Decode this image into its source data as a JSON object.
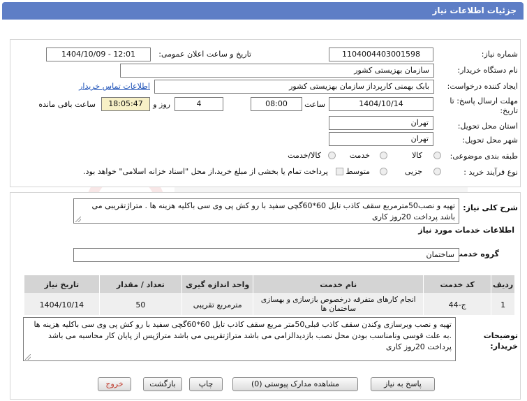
{
  "header": {
    "title": "جزئیات اطلاعات نیاز"
  },
  "form": {
    "need_number_label": "شماره نیاز:",
    "need_number": "1104004403001598",
    "announce_label": "تاریخ و ساعت اعلان عمومی:",
    "announce_value": "1404/10/09 - 12:01",
    "buyer_org_label": "نام دستگاه خریدار:",
    "buyer_org": "سازمان بهزیستی کشور",
    "creator_label": "ایجاد کننده درخواست:",
    "creator": "بابک بهمنی کارپرداز سازمان بهزیستی کشور",
    "contact_link": "اطلاعات تماس خریدار",
    "deadline_label": "مهلت ارسال پاسخ: تا تاریخ:",
    "deadline_date": "1404/10/14",
    "time_label": "ساعت",
    "deadline_time": "08:00",
    "days_value": "4",
    "days_label": "روز و",
    "remaining_time": "18:05:47",
    "remaining_label": "ساعت باقی مانده",
    "province_label": "استان محل تحویل:",
    "province": "تهران",
    "city_label": "شهر محل تحویل:",
    "city": "تهران",
    "category_label": "طبقه بندی موضوعی:",
    "category_options": [
      "کالا",
      "خدمت",
      "کالا/خدمت"
    ],
    "process_label": "نوع فرآیند خرید :",
    "process_options": [
      "جزیی",
      "متوسط"
    ],
    "payment_note": "پرداخت تمام یا بخشی از مبلغ خرید،از محل \"اسناد خزانه اسلامی\" خواهد بود."
  },
  "summary": {
    "label": "شرح کلی نیاز:",
    "text": "تهیه و نصب50مترمربع سقف کاذب تایل 60*60گچی سفید با رو کش پی وی سی باکلیه هزینه ها . متراژتقریبی می باشد پرداخت 20روز کاری"
  },
  "services": {
    "section_title": "اطلاعات خدمات مورد نیاز",
    "group_label": "گروه خدمت:",
    "group_value": "ساختمان",
    "columns": [
      "ردیف",
      "کد خدمت",
      "نام خدمت",
      "واحد اندازه گیری",
      "تعداد / مقدار",
      "تاریخ نیاز"
    ],
    "rows": [
      [
        "1",
        "ج-44",
        "انجام کارهای متفرقه درخصوص بازسازی و بهسازی ساختمان ها",
        "مترمربع تقریبی",
        "50",
        "1404/10/14"
      ]
    ]
  },
  "notes": {
    "label": "توضیحات خریدار:",
    "text": "تهیه و نصب وبرسازی وکندن سقف کاذب قبلی50متر مربع سقف کاذب تایل 60*60گچی سفید با رو کش پی وی سی باکلیه هزینه ها .به علت قوسی ونامناسب بودن محل نصب بازدیدالزامی می باشد متراژتقریبی می باشد متراژپس از پایان کار محاسبه می باشد پرداخت 20روز کاری"
  },
  "buttons": {
    "respond": "پاسخ به نیاز",
    "attachments": "مشاهده مدارک پیوستی (0)",
    "print": "چاپ",
    "back": "بازگشت",
    "exit": "خروج"
  },
  "colors": {
    "header": "#5e7ec6",
    "exit_button_text": "#c0392b"
  }
}
